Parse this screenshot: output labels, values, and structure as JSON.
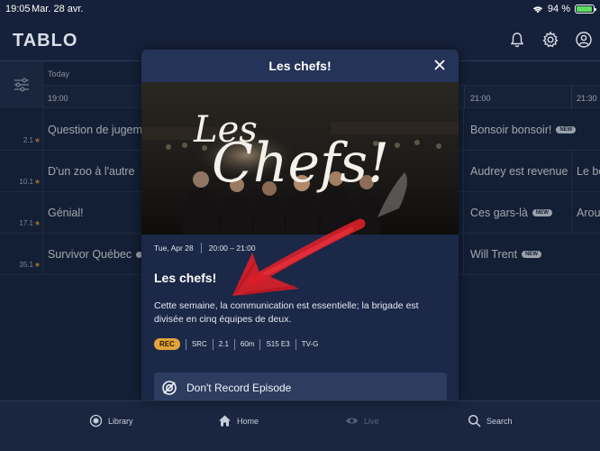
{
  "status": {
    "time": "19:05",
    "date": "Mar. 28 avr.",
    "battery": "94 %",
    "battery_level": 0.94
  },
  "app": {
    "logo": "TABLO"
  },
  "guide": {
    "day": "Today",
    "times": [
      "19:00",
      "21:00",
      "21:30"
    ],
    "rows": [
      {
        "channel": "2.1",
        "programs": [
          {
            "title": "Question de jugem"
          },
          {
            "title": "Bonsoir bonsoir!",
            "badge": "NEW"
          }
        ]
      },
      {
        "channel": "10.1",
        "programs": [
          {
            "title": "D'un zoo à l'autre"
          },
          {
            "title": "Audrey est revenue"
          },
          {
            "title": "Le bo"
          }
        ]
      },
      {
        "channel": "17.1",
        "programs": [
          {
            "title": "Génial!"
          },
          {
            "title": "Ces gars-là",
            "badge": "NEW"
          },
          {
            "title": "Arou"
          }
        ]
      },
      {
        "channel": "35.1",
        "programs": [
          {
            "title": "Survivor Québec"
          },
          {
            "title": "Will Trent",
            "badge": "NEW"
          }
        ]
      }
    ]
  },
  "modal": {
    "title": "Les chefs!",
    "hero_logo_line1": "Les",
    "hero_logo_line2": "Chefs!",
    "date": "Tue, Apr 28",
    "time_range": "20:00 – 21:00",
    "episode_title": "Les chefs!",
    "description": "Cette semaine, la communication est essentielle; la brigade est divisée en cinq équipes de deux.",
    "tags": {
      "rec": "REC",
      "network": "SRC",
      "channel": "2.1",
      "duration": "60m",
      "episode": "S15 E3",
      "rating": "TV-G"
    },
    "action_label": "Don't Record Episode"
  },
  "nav": {
    "library": "Library",
    "home": "Home",
    "live": "Live",
    "search": "Search"
  },
  "colors": {
    "accent": "#e0a43a",
    "annotation": "#d8202a",
    "background": "#15213a"
  }
}
